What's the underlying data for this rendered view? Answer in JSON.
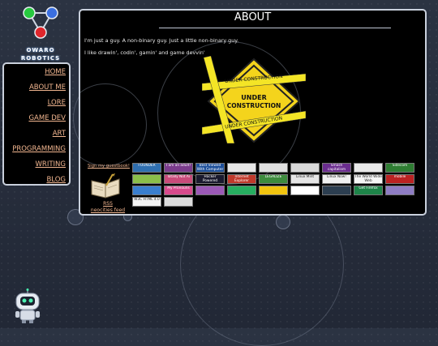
{
  "logo": {
    "line1": "OWARO",
    "line2": "ROBOTICS"
  },
  "nav": {
    "items": [
      {
        "label": "HOME"
      },
      {
        "label": "ABOUT ME"
      },
      {
        "label": "LORE"
      },
      {
        "label": "GAME DEV"
      },
      {
        "label": "ART"
      },
      {
        "label": "PROGRAMMING"
      },
      {
        "label": "WRITING"
      },
      {
        "label": "BLOG"
      }
    ]
  },
  "page": {
    "title": "ABOUT",
    "paragraphs": [
      "I'm just a guy. A non-binary guy. Just a little non-binary guy.",
      "I like drawin', codin', gamin' and game devvin'"
    ]
  },
  "construction": {
    "sign_line1": "UNDER",
    "sign_line2": "CONSTRUCTION",
    "tape_text": "UNDER CONSTRUCTION"
  },
  "guestbook": {
    "label": "Sign my guestbook!"
  },
  "rss": {
    "line1": "RSS",
    "line2": "neocities feed"
  },
  "buttons": [
    {
      "text": "FOUNDER",
      "bg": "#2f6fb0"
    },
    {
      "text": "I am an adult!",
      "bg": "#7a3b8c"
    },
    {
      "text": "Best Viewed With Computer",
      "bg": "#1d4f9a"
    },
    {
      "text": "",
      "bg": "#e8e8e8"
    },
    {
      "text": "",
      "bg": "#e0e0e0"
    },
    {
      "text": "",
      "bg": "#d9d9d9"
    },
    {
      "text": "Smash capitalism",
      "bg": "#6b2d8f"
    },
    {
      "text": "",
      "bg": "#e9e9e9"
    },
    {
      "text": "Sidecom",
      "bg": "#2e7d32"
    },
    {
      "text": "",
      "bg": "#5a3a2e"
    },
    {
      "text": "",
      "bg": "#8bbf4a"
    },
    {
      "text": "Totally Not Ai",
      "bg": "#c94b7a"
    },
    {
      "text": "Hacker Powered",
      "bg": "#1a1a2e"
    },
    {
      "text": "Internet Explorer",
      "bg": "#c0392b"
    },
    {
      "text": "LEGALIZE",
      "bg": "#3d8b3d"
    },
    {
      "text": "Linux Mint",
      "bg": "#e5e5e5"
    },
    {
      "text": "Linux Now!",
      "bg": "#f0f0f0"
    },
    {
      "text": "The World Wide Web",
      "bg": "#f5f5f5"
    },
    {
      "text": "mobile",
      "bg": "#bb2222"
    },
    {
      "text": "",
      "bg": "#3a7fcf"
    },
    {
      "text": "My Pronouns",
      "bg": "#d84a8c"
    },
    {
      "text": "",
      "bg": "#9b59b6"
    },
    {
      "text": "",
      "bg": "#27ae60"
    },
    {
      "text": "",
      "bg": "#f1c40f"
    },
    {
      "text": "",
      "bg": "#ffffff"
    },
    {
      "text": "",
      "bg": "#2c3e50"
    },
    {
      "text": "Get Firefox",
      "bg": "#1e8449"
    },
    {
      "text": "",
      "bg": "#8e7cc3"
    },
    {
      "text": "",
      "bg": "#e67e22"
    },
    {
      "text": "W3C HTML 4.0",
      "bg": "#f4f4f4"
    },
    {
      "text": "",
      "bg": "#dcdcdc"
    }
  ]
}
